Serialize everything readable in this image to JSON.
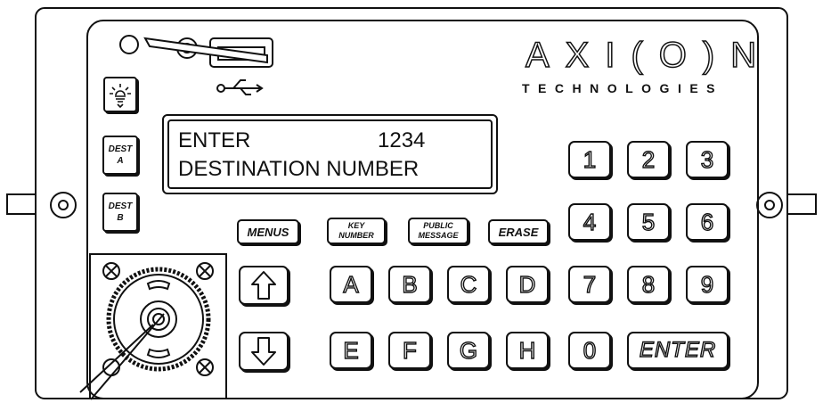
{
  "brand": {
    "logo": "AXI(O)N",
    "tagline": "TECHNOLOGIES"
  },
  "display": {
    "line1_label": "ENTER",
    "line1_value": "1234",
    "line2": "DESTINATION NUMBER"
  },
  "side_keys": {
    "light_icon": "light-bulb-icon",
    "dest_a": [
      "DEST",
      "A"
    ],
    "dest_b": [
      "DEST",
      "B"
    ]
  },
  "function_keys": {
    "menus": "MENUS",
    "key_number": [
      "KEY",
      "NUMBER"
    ],
    "public_message": [
      "PUBLIC",
      "MESSAGE"
    ],
    "erase": "ERASE"
  },
  "keypad": {
    "row1": [
      "1",
      "2",
      "3"
    ],
    "row2": [
      "4",
      "5",
      "6"
    ],
    "row3": [
      "7",
      "8",
      "9"
    ],
    "zero": "0",
    "enter": "ENTER"
  },
  "letter_keys": {
    "row1": [
      "A",
      "B",
      "C",
      "D"
    ],
    "row2": [
      "E",
      "F",
      "G",
      "H"
    ]
  },
  "arrows": {
    "up": "arrow-up-icon",
    "down": "arrow-down-icon"
  },
  "icons": {
    "usb": "usb-icon",
    "key_switch": "key-switch-icon",
    "led": "led-indicator-icon",
    "mount_screw": "screw-icon"
  },
  "colors": {
    "line": "#111111",
    "face": "#ffffff"
  }
}
